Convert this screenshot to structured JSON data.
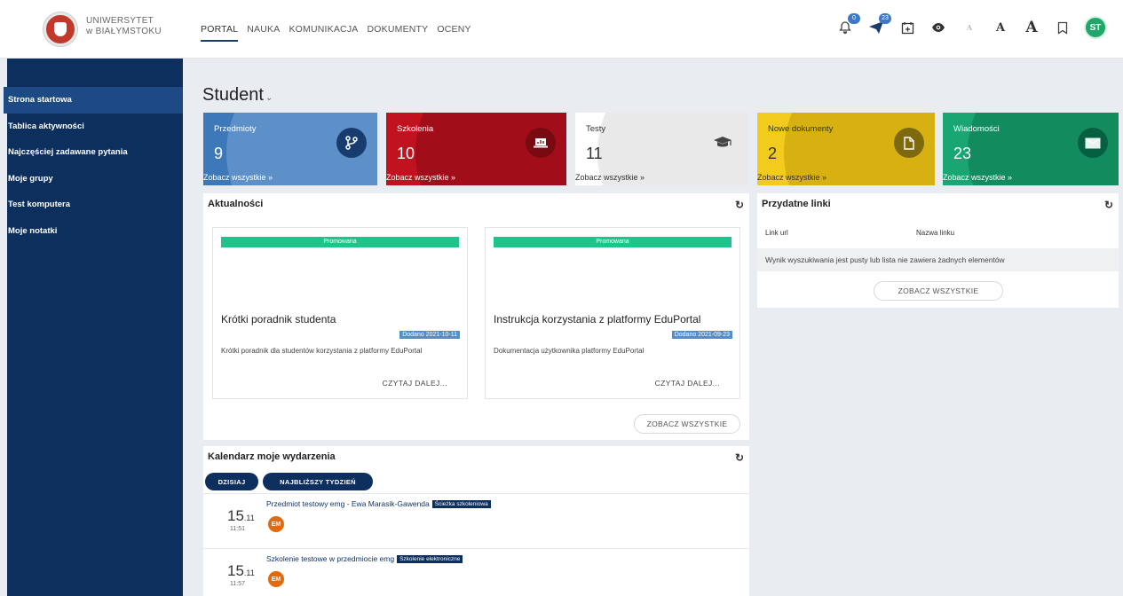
{
  "header": {
    "logo_line1": "UNIWERSYTET",
    "logo_line2": "w BIAŁYMSTOKU",
    "nav": [
      "PORTAL",
      "NAUKA",
      "KOMUNIKACJA",
      "DOKUMENTY",
      "OCENY"
    ],
    "notifications_count": "0",
    "messages_count": "23",
    "font_small": "A",
    "font_medium": "A",
    "font_large": "A",
    "avatar_initials": "ST"
  },
  "sidebar": {
    "items": [
      "Strona startowa",
      "Tablica aktywności",
      "Najczęściej zadawane pytania",
      "Moje grupy",
      "Test komputera",
      "Moje notatki"
    ]
  },
  "page": {
    "title": "Student"
  },
  "tiles": [
    {
      "label": "Przedmioty",
      "value": "9",
      "link": "Zobacz wszystkie »",
      "icon": "branch-icon"
    },
    {
      "label": "Szkolenia",
      "value": "10",
      "link": "Zobacz wszystkie »",
      "icon": "laptop-icon"
    },
    {
      "label": "Testy",
      "value": "11",
      "link": "Zobacz wszystkie »",
      "icon": "graduation-cap-icon"
    },
    {
      "label": "Nowe dokumenty",
      "value": "2",
      "link": "Zobacz wszystkie »",
      "icon": "document-icon"
    },
    {
      "label": "Wiadomości",
      "value": "23",
      "link": "Zobacz wszystkie »",
      "icon": "envelope-icon"
    }
  ],
  "news": {
    "title": "Aktualności",
    "see_all": "ZOBACZ WSZYSTKIE",
    "cards": [
      {
        "badge": "Promowana",
        "title": "Krótki poradnik studenta",
        "date": "Dodano 2021-10-11",
        "desc": "Krótki poradnik dla studentów korzystania z platformy EduPortal",
        "more": "CZYTAJ DALEJ..."
      },
      {
        "badge": "Promowana",
        "title": "Instrukcja korzystania z platformy EduPortal",
        "date": "Dodano 2021-09-23",
        "desc": "Dokumentacja użytkownika platformy EduPortal",
        "more": "CZYTAJ DALEJ..."
      }
    ]
  },
  "links": {
    "title": "Przydatne linki",
    "col_url": "Link url",
    "col_name": "Nazwa linku",
    "empty": "Wynik wyszukiwania jest pusty lub lista nie zawiera żadnych elementów",
    "see_all": "ZOBACZ WSZYSTKIE"
  },
  "calendar": {
    "title": "Kalendarz moje wydarzenia",
    "btn_today": "DZISIAJ",
    "btn_week": "NAJBLIŻSZY TYDZIEŃ",
    "events": [
      {
        "day": "15",
        "month": ".11",
        "time": "11:51",
        "title": "Przedmiot testowy emg - Ewa Marasik-Gawenda",
        "tag": "Ścieżka szkoleniowa",
        "avatar": "EM"
      },
      {
        "day": "15",
        "month": ".11",
        "time": "11:57",
        "title": "Szkolenie testowe w przedmiocie emg",
        "tag": "Szkolenie elektroniczne",
        "avatar": "EM"
      }
    ]
  },
  "colors": {
    "navy": "#0c2f5d",
    "blue_tile": "#3d78b8",
    "red_tile": "#c1121f",
    "yellow_tile": "#f2cb1d",
    "green_tile": "#19a672",
    "promo": "#1ec58b"
  }
}
